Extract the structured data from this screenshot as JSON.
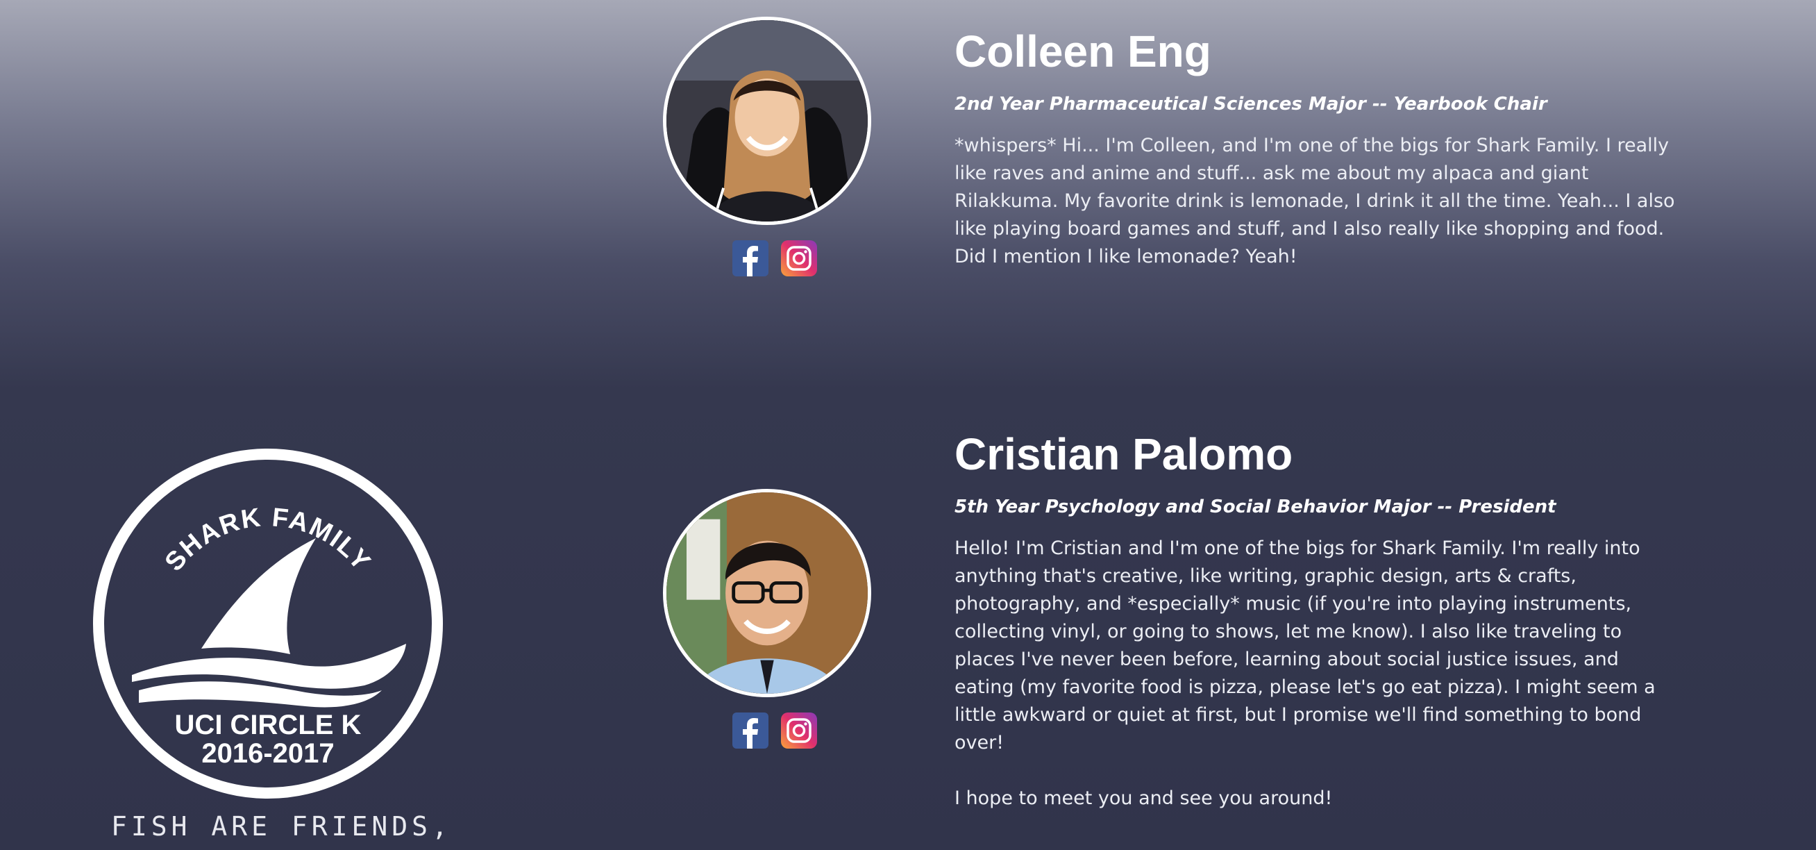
{
  "logo": {
    "top_text": "SHARK FAMILY",
    "line1": "UCI CIRCLE K",
    "line2": "2016-2017",
    "tagline": "FISH ARE FRIENDS,"
  },
  "members": [
    {
      "name": "Colleen Eng",
      "role": "2nd Year Pharmaceutical Sciences Major -- Yearbook Chair",
      "bio": "*whispers* Hi... I'm Colleen, and I'm one of the bigs for Shark Family. I really like raves and anime and stuff... ask me about my alpaca and giant Rilakkuma. My favorite drink is lemonade, I drink it all the time. Yeah... I also like playing board games and stuff, and I also really like shopping and food. Did I mention I like lemonade? Yeah!",
      "bio_extra": ""
    },
    {
      "name": "Cristian Palomo",
      "role": "5th Year Psychology and Social Behavior Major -- President",
      "bio": "Hello! I'm Cristian and I'm one of the bigs for Shark Family. I'm really into anything that's creative, like writing, graphic design, arts & crafts, photography, and *especially* music (if you're into playing instruments, collecting vinyl, or going to shows, let me know). I also like traveling to places I've never been before, learning about social justice issues, and eating (my favorite food is pizza, please let's go eat pizza). I might seem a little awkward or quiet at first, but I promise we'll find something to bond over!",
      "bio_extra": "I hope to meet you and see you around!"
    }
  ],
  "icons": {
    "facebook": "facebook-icon",
    "instagram": "instagram-icon"
  },
  "colors": {
    "facebook": "#3b5998",
    "instagram_start": "#f9a33b",
    "instagram_end": "#8a3ab9"
  }
}
